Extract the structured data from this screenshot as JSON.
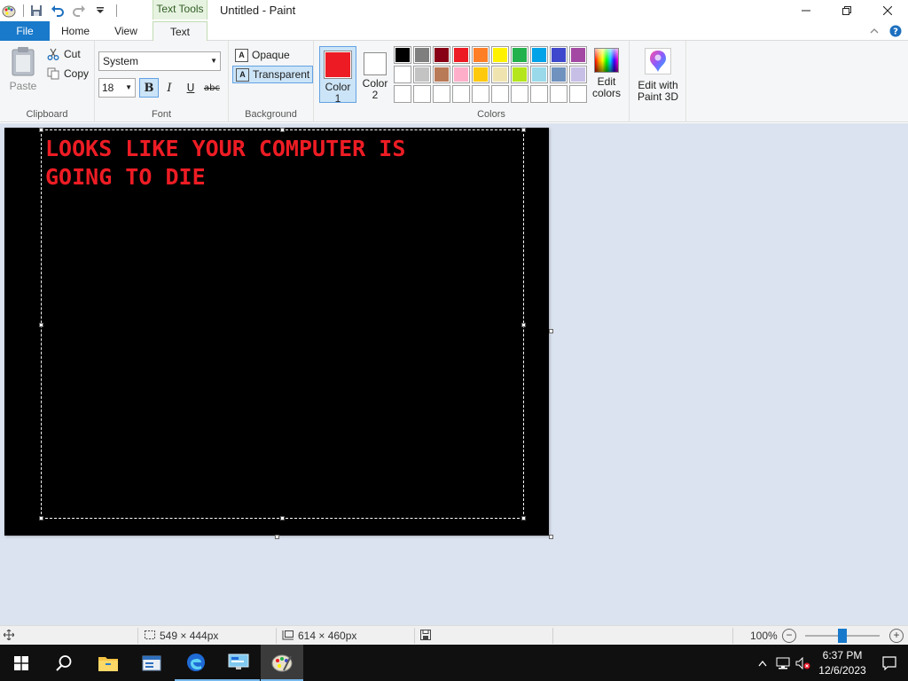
{
  "window": {
    "title": "Untitled - Paint",
    "contextual_tab_header": "Text Tools"
  },
  "tabs": {
    "file": "File",
    "home": "Home",
    "view": "View",
    "text": "Text"
  },
  "clipboard": {
    "paste": "Paste",
    "cut": "Cut",
    "copy": "Copy",
    "group_label": "Clipboard"
  },
  "font": {
    "family": "System",
    "size": "18",
    "bold": "B",
    "italic": "I",
    "underline": "U",
    "strikethrough": "abc",
    "group_label": "Font"
  },
  "background": {
    "opaque": "Opaque",
    "transparent": "Transparent",
    "group_label": "Background"
  },
  "colors": {
    "color1_label": "Color\n1",
    "color1_line1": "Color",
    "color1_line2": "1",
    "color2_line1": "Color",
    "color2_line2": "2",
    "color1_value": "#ed1c24",
    "color2_value": "#ffffff",
    "edit_colors_line1": "Edit",
    "edit_colors_line2": "colors",
    "group_label": "Colors",
    "palette": [
      "#000000",
      "#7f7f7f",
      "#880015",
      "#ed1c24",
      "#ff7f27",
      "#fff200",
      "#22b14c",
      "#00a2e8",
      "#3f48cc",
      "#a349a4",
      "#ffffff",
      "#c3c3c3",
      "#b97a57",
      "#ffaec9",
      "#ffc90e",
      "#efe4b0",
      "#b5e61d",
      "#99d9ea",
      "#7092be",
      "#c8bfe7",
      "",
      "",
      "",
      "",
      "",
      "",
      "",
      "",
      "",
      ""
    ]
  },
  "paint3d": {
    "line1": "Edit with",
    "line2": "Paint 3D"
  },
  "canvas": {
    "text_line1": "LOOKS LIKE YOUR COMPUTER IS",
    "text_line2": "GOING TO DIE",
    "text_color": "#ed1c24",
    "background_color": "#000000"
  },
  "status": {
    "selection_size": "549 × 444px",
    "canvas_size": "614 × 460px",
    "zoom": "100%",
    "zoom_level": 1.0
  },
  "taskbar": {
    "time": "6:37 PM",
    "date": "12/6/2023"
  }
}
